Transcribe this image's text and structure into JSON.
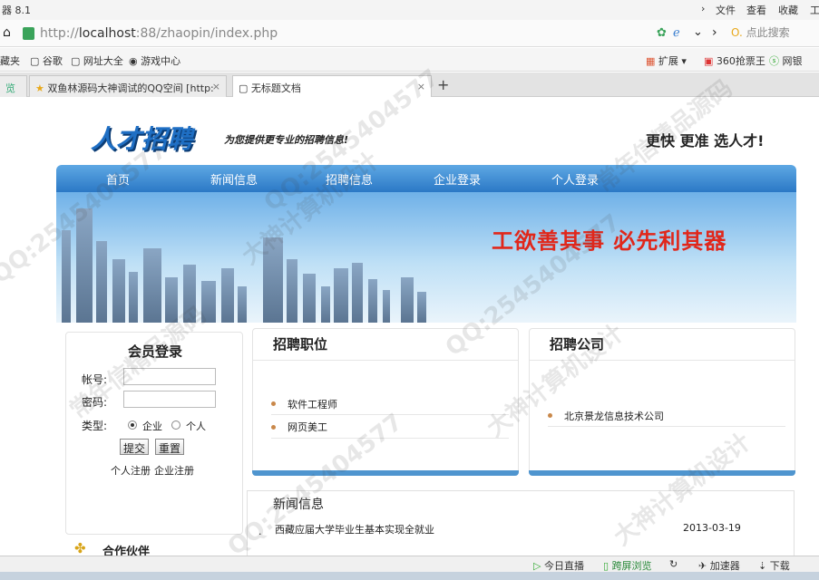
{
  "browser": {
    "title": "器 8.1",
    "menu": [
      "文件",
      "查看",
      "收藏"
    ],
    "url_prefix": "http://",
    "url_host": "localhost",
    "url_rest": ":88/zhaopin/index.php",
    "search_placeholder": "点此搜索"
  },
  "favorites": {
    "items": [
      "藏夹",
      "谷歌",
      "网址大全",
      "游戏中心"
    ],
    "right": [
      "扩展",
      "360抢票王",
      "网银"
    ]
  },
  "tabs": [
    {
      "label": "览"
    },
    {
      "label": "双鱼林源码大神调试的QQ空间 [http:"
    },
    {
      "label": "无标题文档"
    }
  ],
  "site": {
    "logo": "人才招聘",
    "tagline": "为您提供更专业的招聘信息!",
    "slogan": "更快 更准 选人才!",
    "nav": [
      "首页",
      "新闻信息",
      "招聘信息",
      "企业登录",
      "个人登录"
    ],
    "banner_text": "工欲善其事  必先利其器",
    "login": {
      "title": "会员登录",
      "account_label": "帐号:",
      "password_label": "密码:",
      "type_label": "类型:",
      "type_options": [
        "企业",
        "个人"
      ],
      "submit": "提交",
      "reset": "重置",
      "register_person": "个人注册",
      "register_company": "企业注册"
    },
    "partner_title": "合作伙伴",
    "jobs": {
      "title": "招聘职位",
      "items": [
        "软件工程师",
        "网页美工"
      ]
    },
    "companies": {
      "title": "招聘公司",
      "items": [
        "北京景龙信息技术公司"
      ]
    },
    "news": {
      "title": "新闻信息",
      "items": [
        {
          "text": "西藏应届大学毕业生基本实现全就业",
          "date": "2013-03-19"
        }
      ]
    }
  },
  "statusbar": {
    "items": [
      "今日直播",
      "跨屏浏览",
      "加速器",
      "下载"
    ]
  },
  "watermarks": [
    "大神计算机设计",
    "QQ:2545404577",
    "常年信精品源码"
  ],
  "colors": {
    "nav": "#2b78c6",
    "banner_text": "#e0271b",
    "accent_bar": "#4f95cf"
  }
}
